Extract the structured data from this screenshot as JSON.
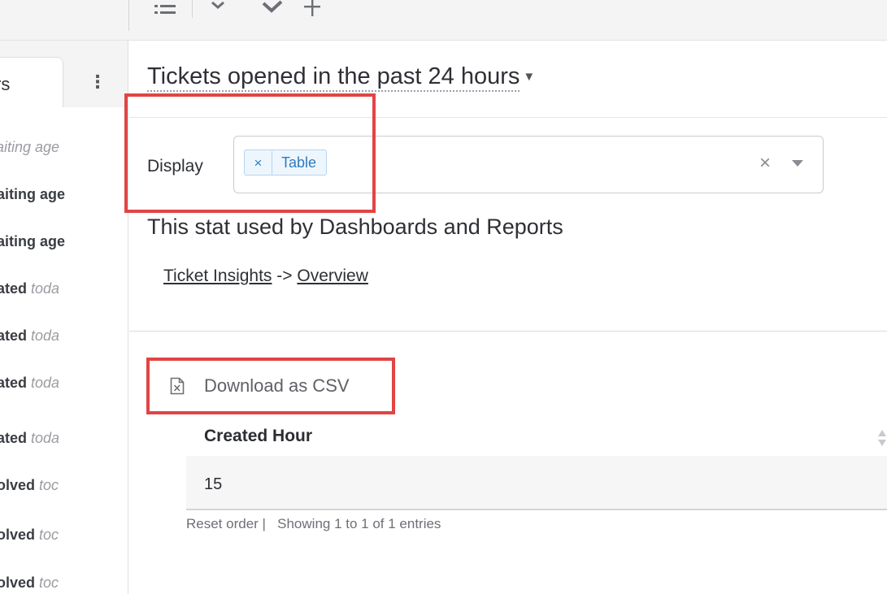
{
  "left_panel": {
    "tab_label": "rs",
    "items": [
      {
        "bold": "",
        "italic": "vaiting age"
      },
      {
        "bold": "vaiting age",
        "italic": ""
      },
      {
        "bold": "vaiting age",
        "italic": ""
      },
      {
        "bold": "eated ",
        "italic": "toda"
      },
      {
        "bold": "eated ",
        "italic": "toda"
      },
      {
        "bold": "eated ",
        "italic": "toda"
      },
      {
        "bold": "eated ",
        "italic": "toda"
      },
      {
        "bold": "solved ",
        "italic": "toc"
      },
      {
        "bold": "solved ",
        "italic": "toc"
      },
      {
        "bold": "solved ",
        "italic": "toc"
      }
    ]
  },
  "stat": {
    "title": "Tickets opened in the past 24 hours",
    "display_label": "Display",
    "display_value": "Table",
    "used_heading": "This stat used by Dashboards and Reports",
    "link_1": "Ticket Insights",
    "link_sep": " -> ",
    "link_2": "Overview"
  },
  "table": {
    "download_label": "Download as CSV",
    "column_header": "Created Hour",
    "rows": [
      "15"
    ],
    "reset_label": "Reset order |",
    "showing_text": "Showing 1 to 1 of 1 entries"
  },
  "colors": {
    "highlight": "#e24444",
    "chip_text": "#2d7bc1"
  }
}
